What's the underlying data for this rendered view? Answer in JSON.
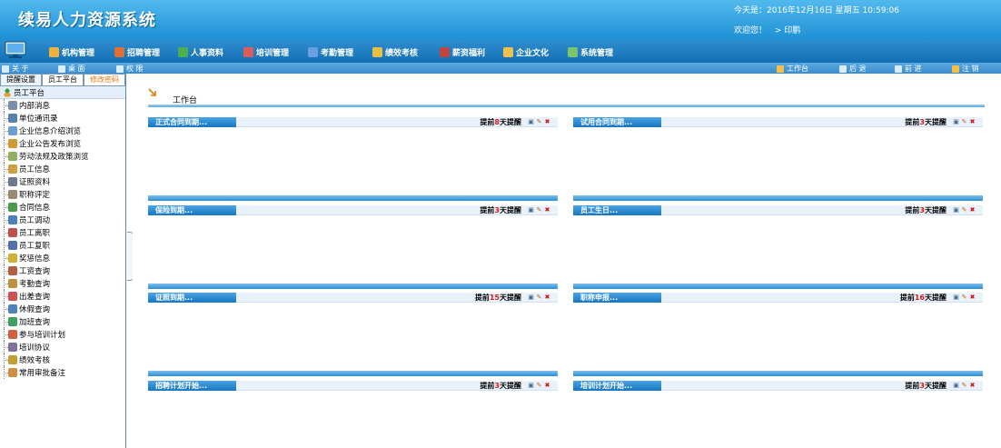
{
  "header": {
    "app_title": "续易人力资源系统",
    "date_line": "今天是：2016年12月16日   星期五   10:59:06",
    "welcome": "欢迎您！",
    "user": "> 印鹏"
  },
  "menu": [
    {
      "label": "机构管理",
      "icon": "org-icon",
      "color": "#f0b13c"
    },
    {
      "label": "招聘管理",
      "icon": "recruit-icon",
      "color": "#e07030"
    },
    {
      "label": "人事资料",
      "icon": "people-icon",
      "color": "#4caf50"
    },
    {
      "label": "培训管理",
      "icon": "training-icon",
      "color": "#e05a5a"
    },
    {
      "label": "考勤管理",
      "icon": "attendance-icon",
      "color": "#6aa0e0"
    },
    {
      "label": "绩效考核",
      "icon": "performance-icon",
      "color": "#e8c040"
    },
    {
      "label": "薪资福利",
      "icon": "salary-icon",
      "color": "#c0453a"
    },
    {
      "label": "企业文化",
      "icon": "culture-icon",
      "color": "#f2c14c"
    },
    {
      "label": "系统管理",
      "icon": "settings-icon",
      "color": "#7cc46a"
    }
  ],
  "toolbar_left": [
    {
      "label": "关  于",
      "icon": "about-icon"
    },
    {
      "label": "桌  面",
      "icon": "desktop-icon"
    },
    {
      "label": "权  限",
      "icon": "permission-icon"
    }
  ],
  "toolbar_right": [
    {
      "label": "工作台",
      "icon": "home-icon"
    },
    {
      "label": "后  退",
      "icon": "back-icon"
    },
    {
      "label": "前  进",
      "icon": "forward-icon"
    },
    {
      "label": "注  销",
      "icon": "logout-icon"
    }
  ],
  "sidebar": {
    "tabs": [
      "提醒设置",
      "员工平台",
      "修改密码"
    ],
    "root": "员工平台",
    "items": [
      {
        "label": "内部消息",
        "color": "#7a8fa8"
      },
      {
        "label": "单位通讯录",
        "color": "#5580b0"
      },
      {
        "label": "企业信息介绍浏览",
        "color": "#6aa0d0"
      },
      {
        "label": "企业公告发布浏览",
        "color": "#d09a30"
      },
      {
        "label": "劳动法规及政策浏览",
        "color": "#8fb060"
      },
      {
        "label": "员工信息",
        "color": "#d0a040"
      },
      {
        "label": "证照资料",
        "color": "#6a7a90"
      },
      {
        "label": "职称评定",
        "color": "#9a8a70"
      },
      {
        "label": "合同信息",
        "color": "#4a9a50"
      },
      {
        "label": "员工调动",
        "color": "#4a80c0"
      },
      {
        "label": "员工离职",
        "color": "#c05050"
      },
      {
        "label": "员工复职",
        "color": "#5070b0"
      },
      {
        "label": "奖惩信息",
        "color": "#d0b030"
      },
      {
        "label": "工资查询",
        "color": "#b06040"
      },
      {
        "label": "考勤查询",
        "color": "#c09040"
      },
      {
        "label": "出差查询",
        "color": "#d05050"
      },
      {
        "label": "休假查询",
        "color": "#5080c0"
      },
      {
        "label": "加班查询",
        "color": "#40a060"
      },
      {
        "label": "参与培训计划",
        "color": "#d06040"
      },
      {
        "label": "培训协议",
        "color": "#8070a0"
      },
      {
        "label": "绩效考核",
        "color": "#c0a030"
      },
      {
        "label": "常用审批备注",
        "color": "#d09040"
      }
    ]
  },
  "workbench_title": "工作台",
  "panels": [
    {
      "title": "正式合同到期...",
      "pre": "提前",
      "days": "8",
      "post": "天提醒"
    },
    {
      "title": "试用合同到期...",
      "pre": "提前",
      "days": "3",
      "post": "天提醒"
    },
    {
      "title": "保险到期...",
      "pre": "提前",
      "days": "3",
      "post": "天提醒"
    },
    {
      "title": "员工生日...",
      "pre": "提前",
      "days": "3",
      "post": "天提醒"
    },
    {
      "title": "证照到期...",
      "pre": "提前",
      "days": "15",
      "post": "天提醒"
    },
    {
      "title": "职称申报...",
      "pre": "提前",
      "days": "16",
      "post": "天提醒"
    },
    {
      "title": "招聘计划开始...",
      "pre": "提前",
      "days": "3",
      "post": "天提醒"
    },
    {
      "title": "培训计划开始...",
      "pre": "提前",
      "days": "3",
      "post": "天提醒"
    }
  ]
}
